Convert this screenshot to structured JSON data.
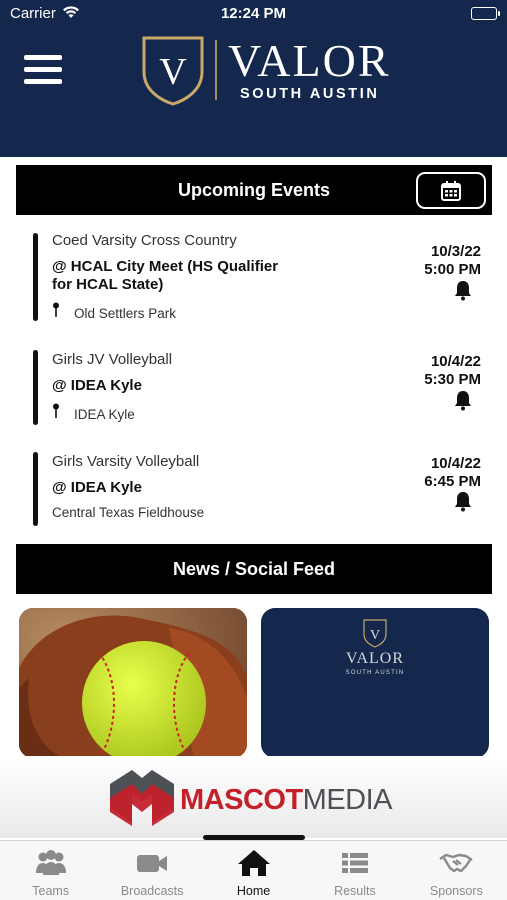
{
  "status_bar": {
    "carrier": "Carrier",
    "time": "12:24 PM"
  },
  "header": {
    "logo_letter": "V",
    "logo_word": "VALOR",
    "logo_sub": "SOUTH AUSTIN"
  },
  "upcoming": {
    "title": "Upcoming Events",
    "events": [
      {
        "sport": "Coed Varsity Cross Country",
        "opponent": "@ HCAL City Meet (HS Qualifier for HCAL State)",
        "location": "Old Settlers Park",
        "date": "10/3/22",
        "time": "5:00 PM",
        "has_pin": true
      },
      {
        "sport": "Girls JV Volleyball",
        "opponent": "@ IDEA Kyle",
        "location": "IDEA Kyle",
        "date": "10/4/22",
        "time": "5:30 PM",
        "has_pin": true
      },
      {
        "sport": "Girls Varsity Volleyball",
        "opponent": "@ IDEA Kyle",
        "location": "Central Texas Fieldhouse",
        "date": "10/4/22",
        "time": "6:45 PM",
        "has_pin": false
      }
    ]
  },
  "news": {
    "title": "News / Social Feed",
    "card_logo_word": "VALOR",
    "card_logo_sub": "SOUTH AUSTIN",
    "card_logo_letter": "V"
  },
  "sponsor": {
    "brand_red": "MASCOT",
    "brand_gray": "MEDIA"
  },
  "tabs": [
    {
      "label": "Teams",
      "icon": "teams-icon",
      "active": false
    },
    {
      "label": "Broadcasts",
      "icon": "video-camera-icon",
      "active": false
    },
    {
      "label": "Home",
      "icon": "home-icon",
      "active": true
    },
    {
      "label": "Results",
      "icon": "list-icon",
      "active": false
    },
    {
      "label": "Sponsors",
      "icon": "handshake-icon",
      "active": false
    }
  ],
  "colors": {
    "navy": "#13284c",
    "gold": "#c9a86a",
    "brand_red": "#c4202a"
  }
}
